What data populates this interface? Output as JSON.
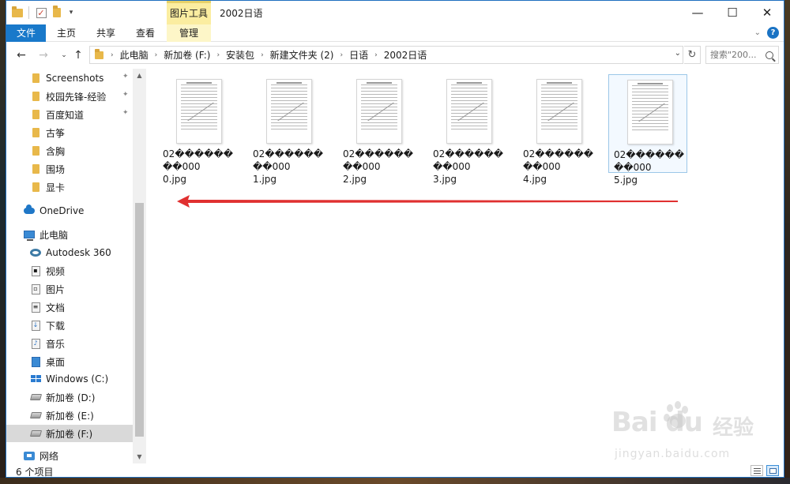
{
  "window": {
    "title": "2002日语",
    "context_tab": "图片工具",
    "minimize": "—",
    "maximize": "☐",
    "close": "✕"
  },
  "ribbon": {
    "tabs": [
      "文件",
      "主页",
      "共享",
      "查看",
      "管理"
    ],
    "help": "?"
  },
  "address": {
    "breadcrumbs": [
      "此电脑",
      "新加卷 (F:)",
      "安装包",
      "新建文件夹 (2)",
      "日语",
      "2002日语"
    ],
    "search_placeholder": "搜索\"200..."
  },
  "nav": {
    "quick_access": [
      {
        "label": "Screenshots",
        "pinned": true
      },
      {
        "label": "校园先锋-经验",
        "pinned": true
      },
      {
        "label": "百度知道",
        "pinned": true
      },
      {
        "label": "古筝",
        "pinned": false
      },
      {
        "label": "含胸",
        "pinned": false
      },
      {
        "label": "围场",
        "pinned": false
      },
      {
        "label": "显卡",
        "pinned": false
      }
    ],
    "onedrive": "OneDrive",
    "this_pc": "此电脑",
    "pc_items": [
      "Autodesk 360",
      "视频",
      "图片",
      "文档",
      "下载",
      "音乐",
      "桌面"
    ],
    "drives": [
      "Windows (C:)",
      "新加卷 (D:)",
      "新加卷 (E:)",
      "新加卷 (F:)"
    ],
    "network": "网络"
  },
  "files": [
    {
      "line1": "02��������000",
      "line2": "0.jpg"
    },
    {
      "line1": "02��������000",
      "line2": "1.jpg"
    },
    {
      "line1": "02��������000",
      "line2": "2.jpg"
    },
    {
      "line1": "02��������000",
      "line2": "3.jpg"
    },
    {
      "line1": "02��������000",
      "line2": "4.jpg"
    },
    {
      "line1": "02��������000",
      "line2": "5.jpg"
    }
  ],
  "status": {
    "count": "6 个项目"
  },
  "watermark": {
    "logo": "Bai du",
    "cn": "经验",
    "url": "jingyan.baidu.com"
  },
  "colors": {
    "accent": "#1979ca",
    "context_tab": "#fbeda0",
    "arrow": "#e03030"
  }
}
